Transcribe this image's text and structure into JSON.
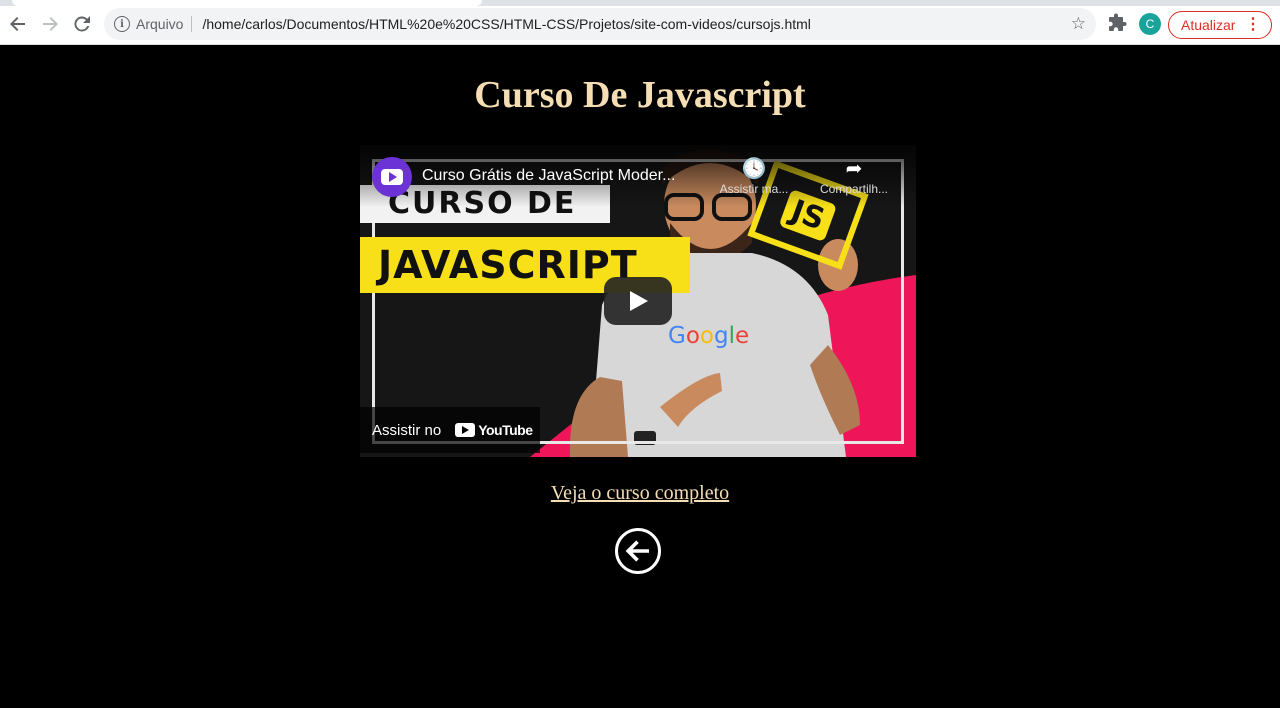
{
  "browser": {
    "nav": {
      "back_icon": "arrow-left-icon",
      "forward_icon": "arrow-right-icon",
      "reload_icon": "reload-icon"
    },
    "omnibox": {
      "security_label": "Arquivo",
      "url": "/home/carlos/Documentos/HTML%20e%20CSS/HTML-CSS/Projetos/site-com-videos/cursojs.html"
    },
    "profile_initial": "C",
    "update_label": "Atualizar",
    "update_color": "#d93025"
  },
  "page": {
    "title": "Curso De Javascript",
    "title_color": "#f5deb3",
    "background": "#000000",
    "video": {
      "title": "Curso Grátis de JavaScript Moder...",
      "watch_later": "Assistir ma...",
      "share": "Compartilh...",
      "thumb_line1": "CURSO DE",
      "thumb_line2": "JAVASCRIPT",
      "thumb_badge": "JS",
      "watch_on": "Assistir no",
      "youtube": "YouTube",
      "shirt_brand": "Google"
    },
    "course_link": "Veja o curso completo",
    "back_icon": "circle-arrow-left-icon"
  }
}
